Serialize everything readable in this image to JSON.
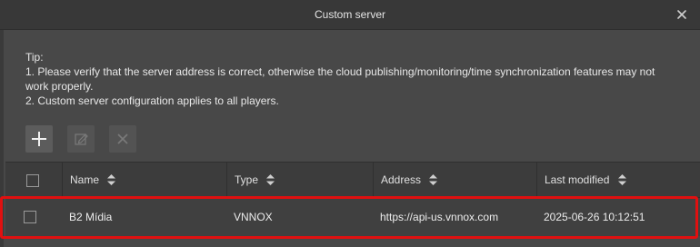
{
  "dialog": {
    "title": "Custom server"
  },
  "tip": {
    "heading": "Tip:",
    "line1": "1. Please verify that the server address is correct, otherwise the cloud publishing/monitoring/time synchronization features may not",
    "line1b": "work properly.",
    "line2": "2. Custom server configuration applies to all players."
  },
  "toolbar": {
    "add_icon": "plus-icon",
    "edit_icon": "edit-icon",
    "delete_icon": "close-icon"
  },
  "table": {
    "columns": [
      "Name",
      "Type",
      "Address",
      "Last modified"
    ],
    "rows": [
      {
        "name": "B2 Mídia",
        "type": "VNNOX",
        "address": "https://api-us.vnnox.com",
        "modified": "2025-06-26 10:12:51"
      }
    ]
  },
  "colors": {
    "highlight": "#e01010",
    "background": "#484848"
  }
}
